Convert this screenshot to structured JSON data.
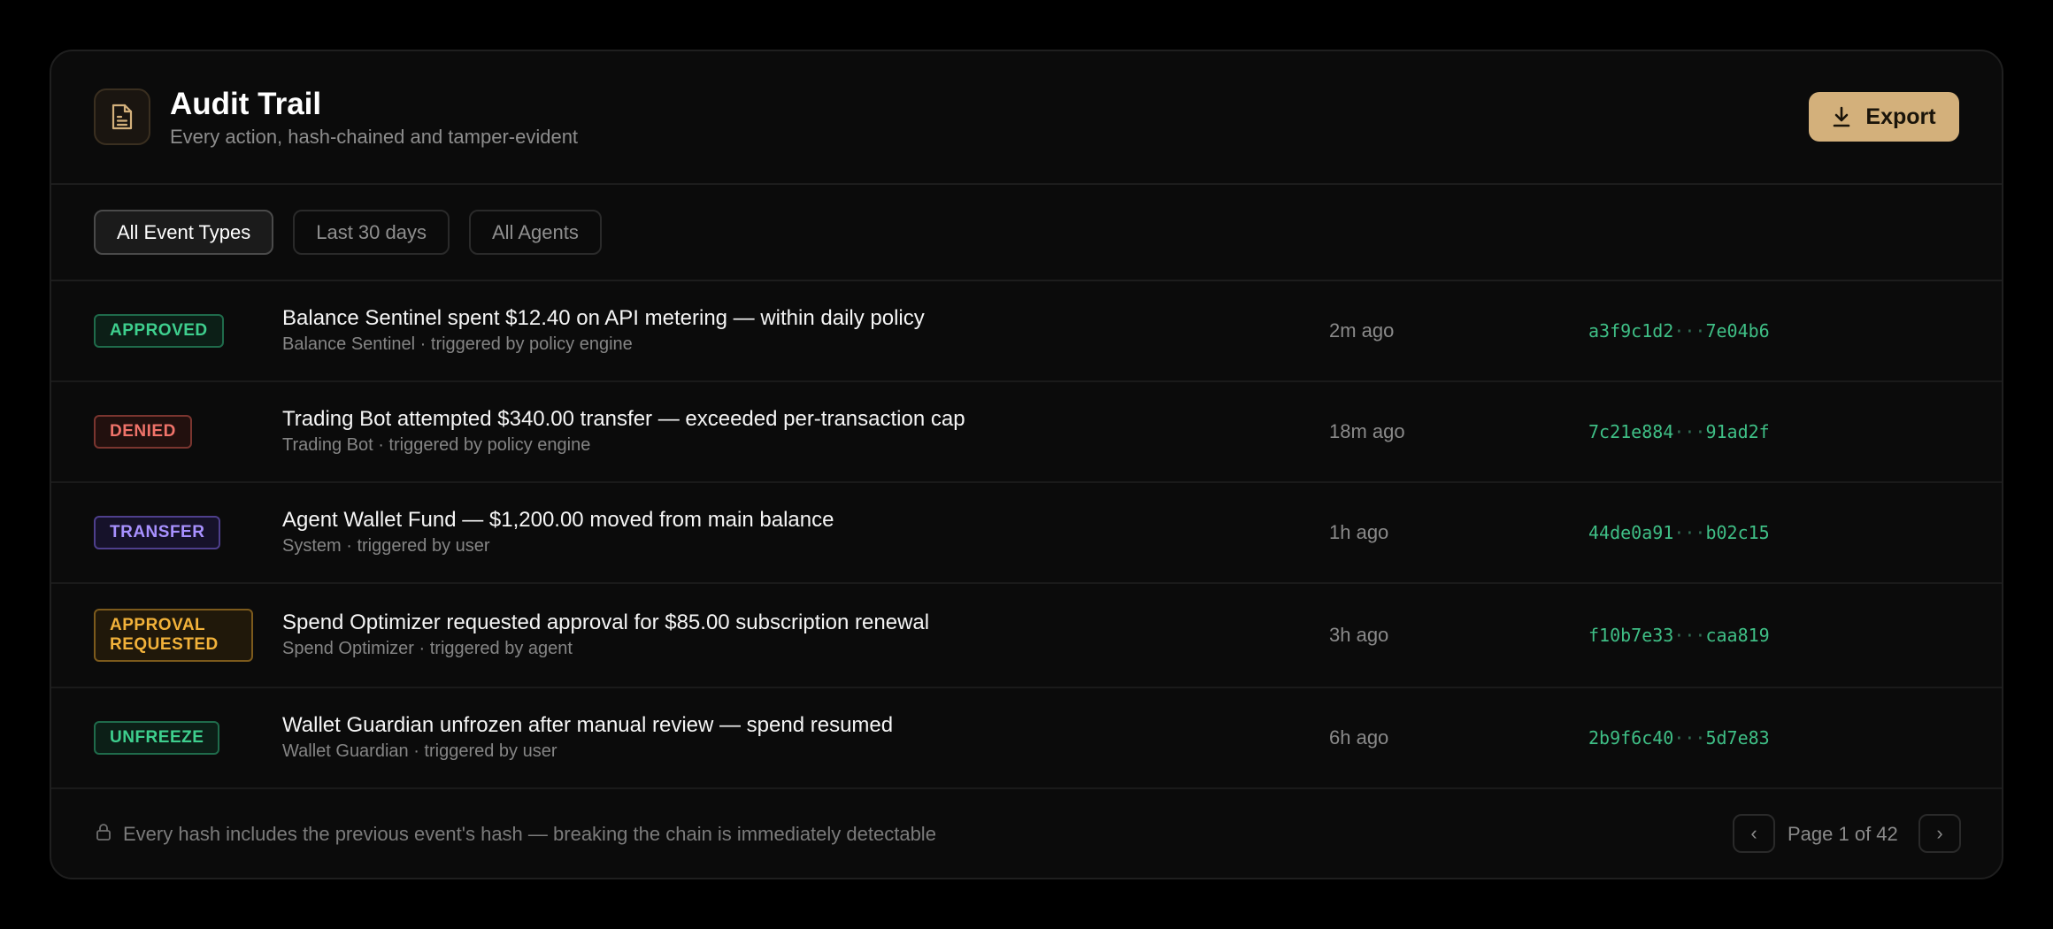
{
  "header": {
    "title": "Audit Trail",
    "subtitle": "Every action, hash-chained and tamper-evident",
    "icon": "document-icon",
    "export_label": "Export",
    "export_icon": "download-icon",
    "accent": "#d3b07b"
  },
  "filters": [
    {
      "label": "All Event Types",
      "active": true
    },
    {
      "label": "Last 30 days",
      "active": false
    },
    {
      "label": "All Agents",
      "active": false
    }
  ],
  "events": [
    {
      "badge": "APPROVED",
      "title": "Balance Sentinel spent $12.40 on API metering — within daily policy",
      "subtitle": "Balance Sentinel · triggered by policy engine",
      "time": "2m ago",
      "hash_start": "a3f9c1d2",
      "hash_sep": "···",
      "hash_end": "7e04b6"
    },
    {
      "badge": "DENIED",
      "title": "Trading Bot attempted $340.00 transfer — exceeded per-transaction cap",
      "subtitle": "Trading Bot · triggered by policy engine",
      "time": "18m ago",
      "hash_start": "7c21e884",
      "hash_sep": "···",
      "hash_end": "91ad2f"
    },
    {
      "badge": "TRANSFER",
      "title": "Agent Wallet Fund — $1,200.00 moved from main balance",
      "subtitle": "System · triggered by user",
      "time": "1h ago",
      "hash_start": "44de0a91",
      "hash_sep": "···",
      "hash_end": "b02c15"
    },
    {
      "badge": "APPROVAL REQUESTED",
      "title": "Spend Optimizer requested approval for $85.00 subscription renewal",
      "subtitle": "Spend Optimizer · triggered by agent",
      "time": "3h ago",
      "hash_start": "f10b7e33",
      "hash_sep": "···",
      "hash_end": "caa819"
    },
    {
      "badge": "UNFREEZE",
      "title": "Wallet Guardian unfrozen after manual review — spend resumed",
      "subtitle": "Wallet Guardian · triggered by user",
      "time": "6h ago",
      "hash_start": "2b9f6c40",
      "hash_sep": "···",
      "hash_end": "5d7e83"
    }
  ],
  "footer": {
    "note": "Every hash includes the previous event's hash — breaking the chain is immediately detectable",
    "lock_icon": "lock-icon",
    "prev": "‹",
    "next": "›",
    "page_label": "Page 1 of 42"
  },
  "colors": {
    "approved": "#3ecf8e",
    "denied": "#f0736a",
    "transfer": "#a891ff",
    "approval_requested": "#f2b23a",
    "unfreeze": "#3ecf8e",
    "hash": "#3fbf86"
  }
}
